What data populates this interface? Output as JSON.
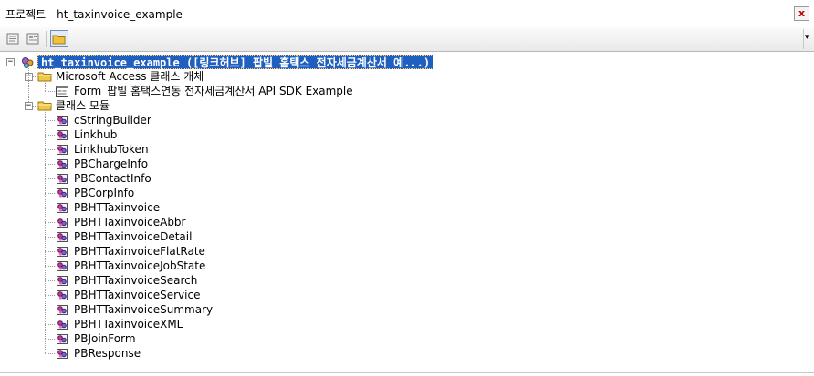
{
  "window": {
    "title": "프로젝트 - ht_taxinvoice_example",
    "close_label": "x"
  },
  "toolbar": {
    "buttons": [
      {
        "name": "view-code",
        "icon": "code-view-icon"
      },
      {
        "name": "view-object",
        "icon": "object-view-icon"
      },
      {
        "name": "toggle-folders",
        "icon": "folder-icon",
        "pressed": true
      }
    ],
    "overflow_label": "▾"
  },
  "tree": {
    "root": {
      "label": "ht_taxinvoice_example ([링크허브] 팝빌 홈택스 전자세금계산서 예...)",
      "expanded": true,
      "icon": "project-icon"
    },
    "folders": [
      {
        "label": "Microsoft Access 클래스 개체",
        "expanded": true,
        "icon": "folder-icon",
        "items": [
          {
            "label": "Form_팝빌 홈택스연동 전자세금계산서 API SDK Example",
            "icon": "form-icon"
          }
        ]
      },
      {
        "label": "클래스 모듈",
        "expanded": true,
        "icon": "folder-icon",
        "items": [
          {
            "label": "cStringBuilder",
            "icon": "class-module-icon"
          },
          {
            "label": "Linkhub",
            "icon": "class-module-icon"
          },
          {
            "label": "LinkhubToken",
            "icon": "class-module-icon"
          },
          {
            "label": "PBChargeInfo",
            "icon": "class-module-icon"
          },
          {
            "label": "PBContactInfo",
            "icon": "class-module-icon"
          },
          {
            "label": "PBCorpInfo",
            "icon": "class-module-icon"
          },
          {
            "label": "PBHTTaxinvoice",
            "icon": "class-module-icon"
          },
          {
            "label": "PBHTTaxinvoiceAbbr",
            "icon": "class-module-icon"
          },
          {
            "label": "PBHTTaxinvoiceDetail",
            "icon": "class-module-icon"
          },
          {
            "label": "PBHTTaxinvoiceFlatRate",
            "icon": "class-module-icon"
          },
          {
            "label": "PBHTTaxinvoiceJobState",
            "icon": "class-module-icon"
          },
          {
            "label": "PBHTTaxinvoiceSearch",
            "icon": "class-module-icon"
          },
          {
            "label": "PBHTTaxinvoiceService",
            "icon": "class-module-icon"
          },
          {
            "label": "PBHTTaxinvoiceSummary",
            "icon": "class-module-icon"
          },
          {
            "label": "PBHTTaxinvoiceXML",
            "icon": "class-module-icon"
          },
          {
            "label": "PBJoinForm",
            "icon": "class-module-icon"
          },
          {
            "label": "PBResponse",
            "icon": "class-module-icon"
          }
        ]
      }
    ]
  },
  "colors": {
    "selection": "#1f5fbf",
    "folder": "#e8c04a"
  }
}
